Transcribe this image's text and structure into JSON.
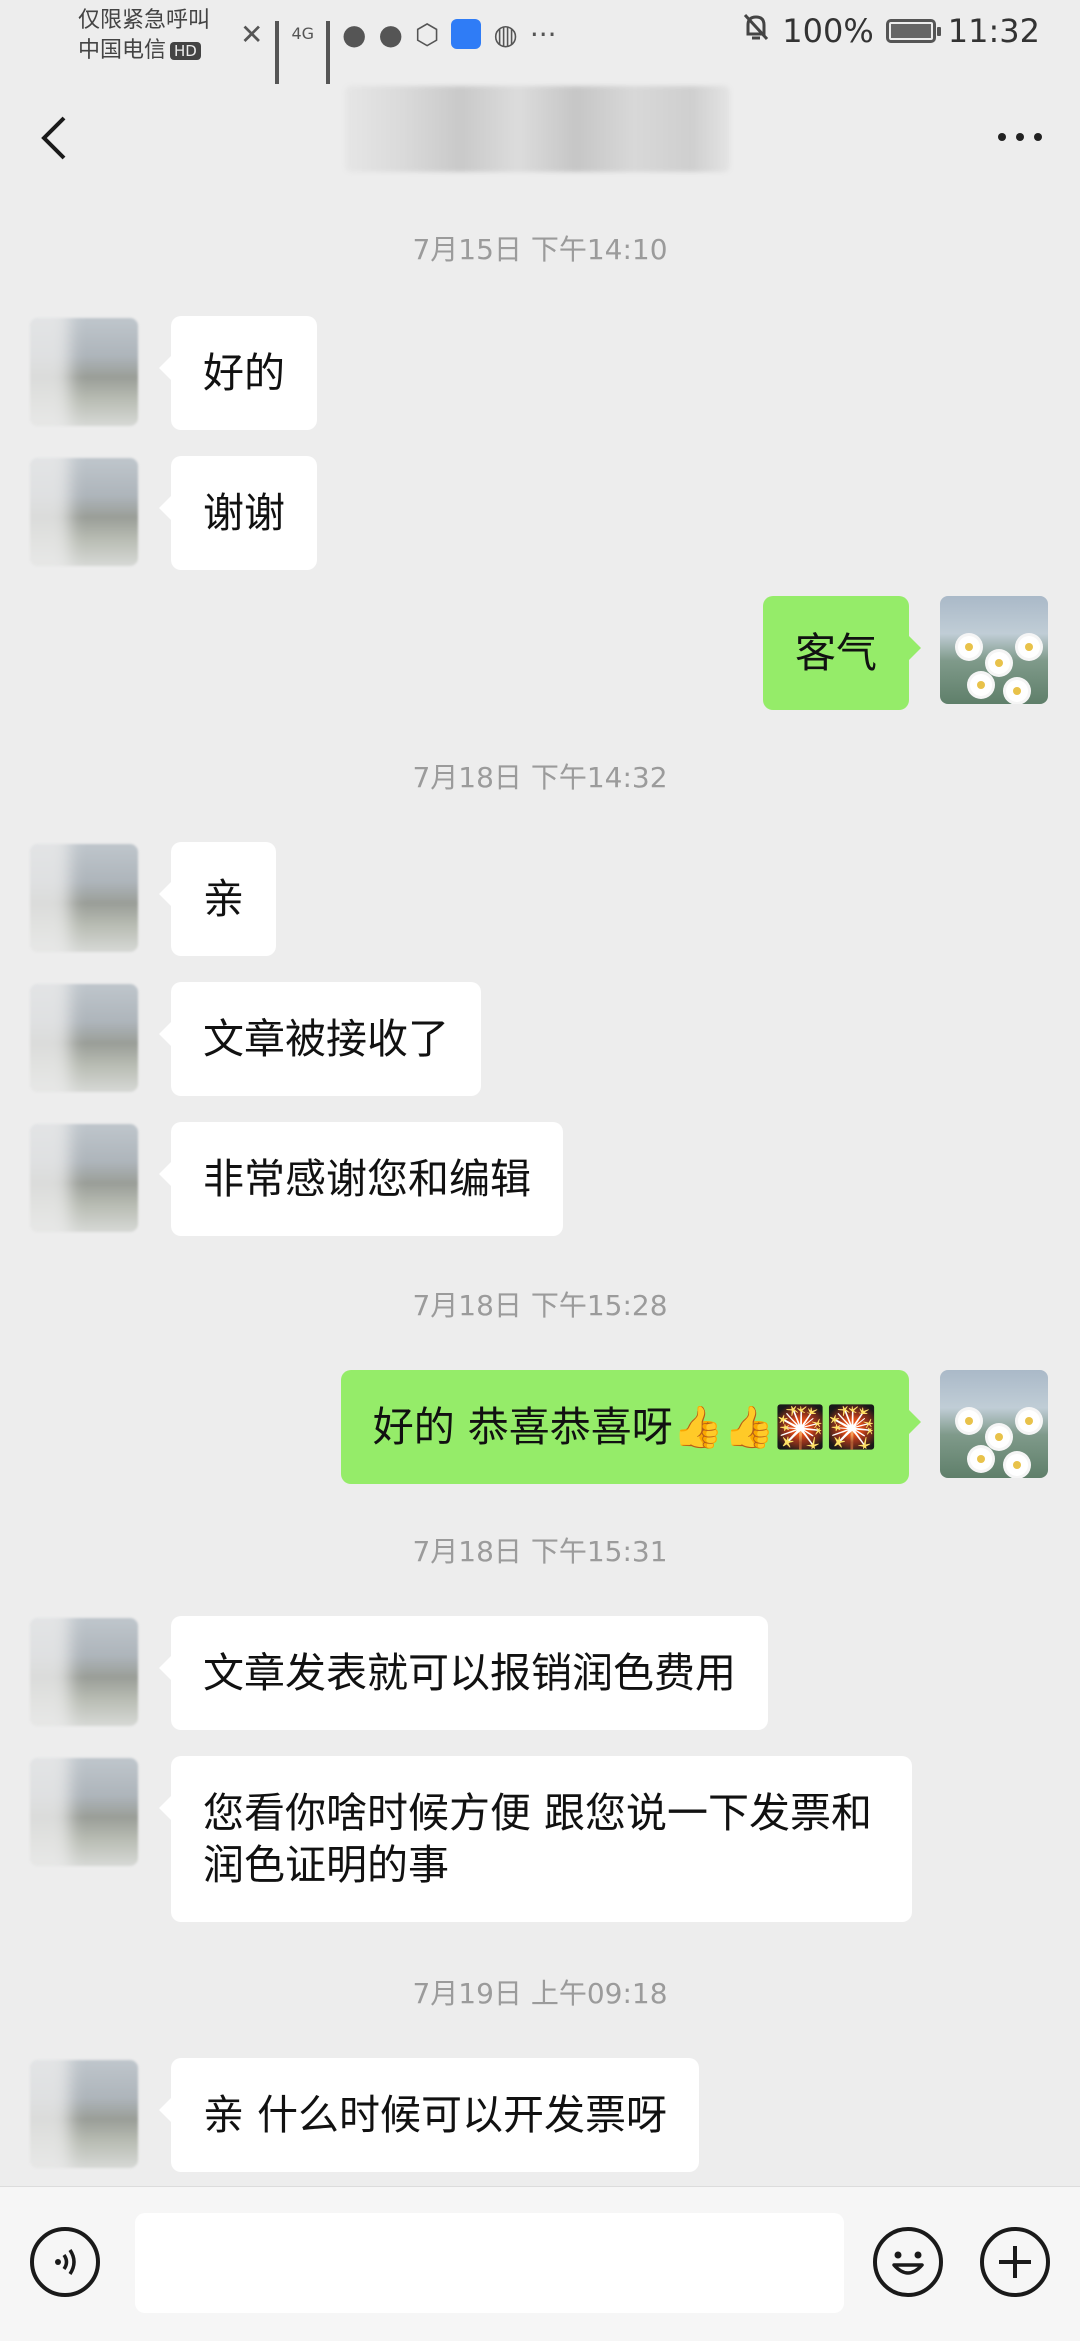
{
  "status_bar": {
    "line1": "仅限紧急呼叫",
    "carrier": "中国电信",
    "hd": "HD",
    "network": "4G",
    "more": "···",
    "battery": "100%",
    "time": "11:32"
  },
  "header": {
    "title": ""
  },
  "timestamps": [
    "7月15日 下午14:10",
    "7月18日 下午14:32",
    "7月18日 下午15:28",
    "7月18日 下午15:31",
    "7月19日 上午09:18"
  ],
  "messages": [
    {
      "side": "in",
      "text": "好的"
    },
    {
      "side": "in",
      "text": "谢谢"
    },
    {
      "side": "out",
      "text": "客气"
    },
    {
      "side": "in",
      "text": "亲"
    },
    {
      "side": "in",
      "text": "文章被接收了"
    },
    {
      "side": "in",
      "text": "非常感谢您和编辑"
    },
    {
      "side": "out",
      "text": "好的 恭喜恭喜呀👍👍🎇🎇"
    },
    {
      "side": "in",
      "text": "文章发表就可以报销润色费用"
    },
    {
      "side": "in",
      "text": "您看你啥时候方便  跟您说一下发票和润色证明的事"
    },
    {
      "side": "in",
      "text": "亲 什么时候可以开发票呀"
    }
  ],
  "input": {
    "value": "",
    "placeholder": ""
  },
  "colors": {
    "background": "#ededed",
    "outgoing_bubble": "#95ec69",
    "incoming_bubble": "#ffffff",
    "timestamp": "#9b9b9b"
  },
  "icons": [
    "back-icon",
    "more-icon",
    "voice-icon",
    "emoji-icon",
    "plus-icon"
  ]
}
